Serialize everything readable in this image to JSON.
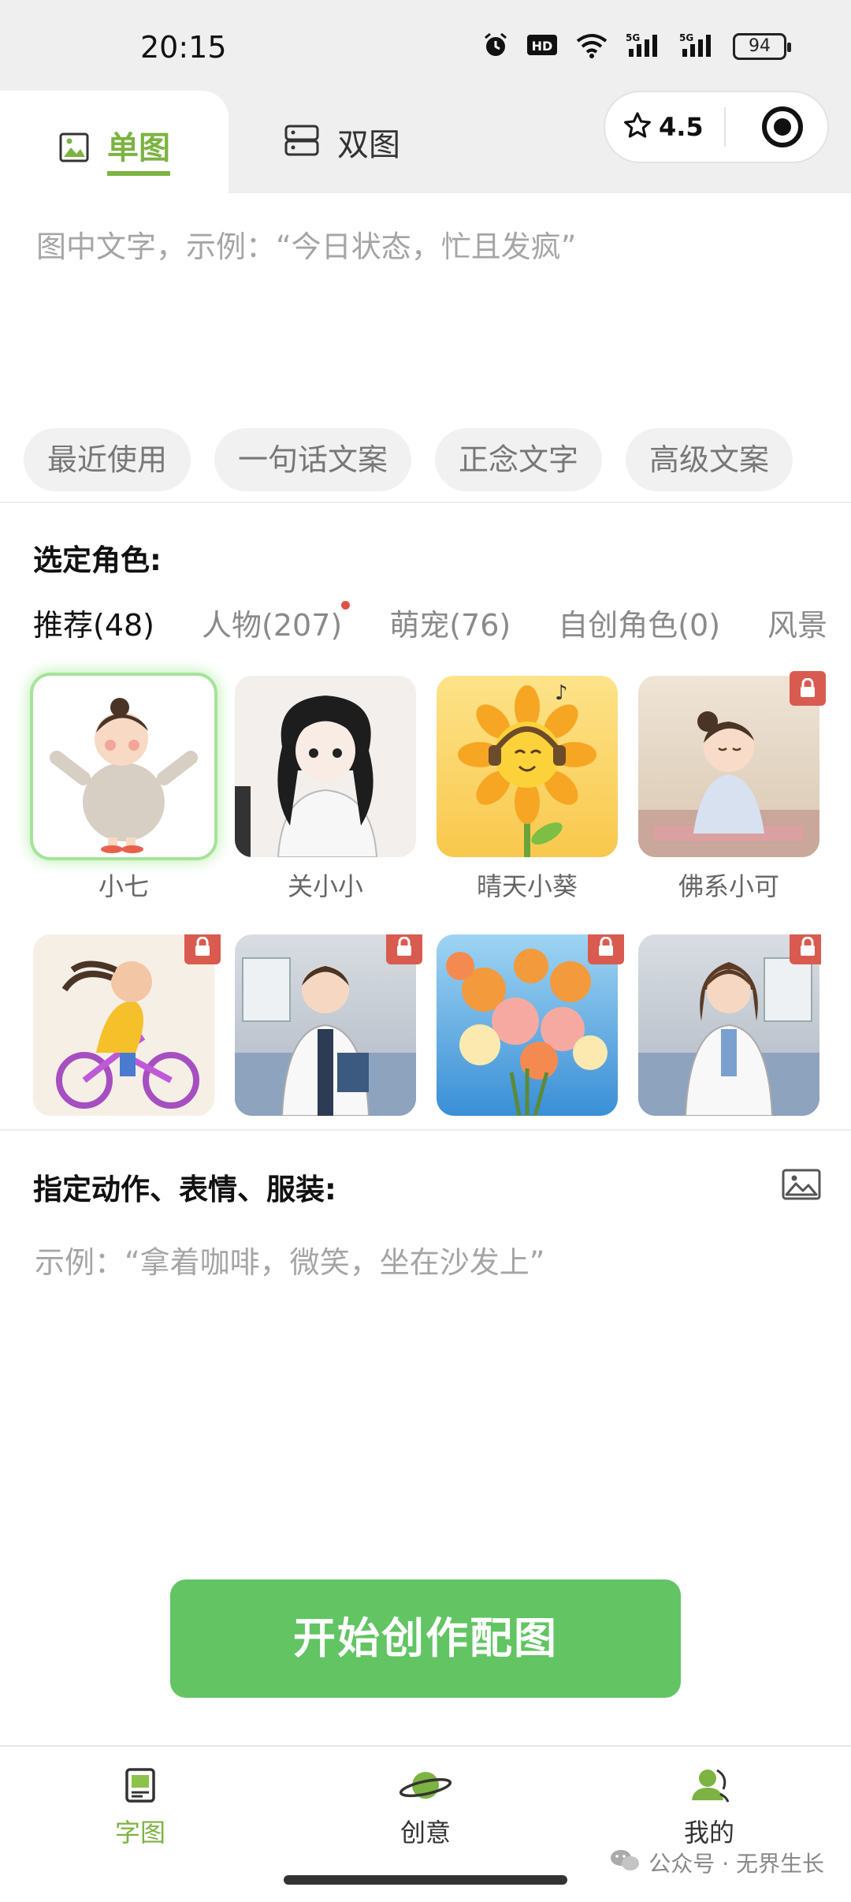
{
  "status_bar": {
    "time": "20:15",
    "battery": "94",
    "network": "5G"
  },
  "top_tabs": {
    "single": "单图",
    "double": "双图"
  },
  "capsule": {
    "rating": "4.5"
  },
  "caption_input": {
    "placeholder": "图中文字，示例：“今日状态，忙且发疯”"
  },
  "chips": [
    "最近使用",
    "一句话文案",
    "正念文字",
    "高级文案"
  ],
  "character_section": {
    "title": "选定角色:",
    "categories": [
      "推荐(48)",
      "人物(207)",
      "萌宠(76)",
      "自创角色(0)",
      "风景"
    ],
    "row1": [
      {
        "name": "小七",
        "locked": false,
        "selected": true
      },
      {
        "name": "关小小",
        "locked": false,
        "selected": false
      },
      {
        "name": "晴天小葵",
        "locked": false,
        "selected": false
      },
      {
        "name": "佛系小可",
        "locked": true,
        "selected": false
      }
    ],
    "row2": [
      {
        "name": "",
        "locked": true
      },
      {
        "name": "",
        "locked": true
      },
      {
        "name": "",
        "locked": true
      },
      {
        "name": "",
        "locked": true
      }
    ]
  },
  "action_section": {
    "title": "指定动作、表情、服装:",
    "placeholder": "示例：“拿着咖啡，微笑，坐在沙发上”"
  },
  "cta_label": "开始创作配图",
  "bottom_nav": [
    {
      "label": "字图",
      "active": true
    },
    {
      "label": "创意",
      "active": false
    },
    {
      "label": "我的",
      "active": false
    }
  ],
  "watermark": "公众号 · 无界生长",
  "colors": {
    "accent": "#7cb342",
    "cta": "#62c463",
    "lock": "#d95b4f"
  }
}
